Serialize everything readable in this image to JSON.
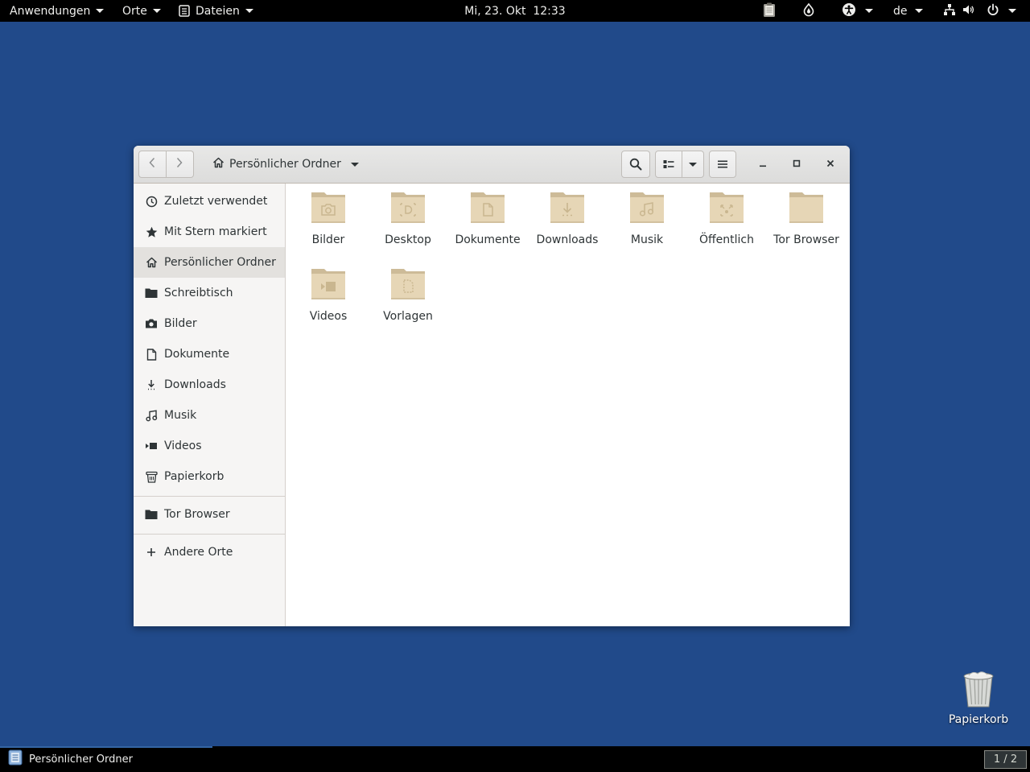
{
  "topbar": {
    "applications": "Anwendungen",
    "places": "Orte",
    "files_menu": "Dateien",
    "clock": "Mi, 23. Okt  12:33",
    "language": "de"
  },
  "window": {
    "location": "Persönlicher Ordner"
  },
  "sidebar": {
    "items": [
      {
        "label": "Zuletzt verwendet",
        "icon": "clock-icon"
      },
      {
        "label": "Mit Stern markiert",
        "icon": "star-icon"
      },
      {
        "label": "Persönlicher Ordner",
        "icon": "home-icon"
      },
      {
        "label": "Schreibtisch",
        "icon": "folder-icon"
      },
      {
        "label": "Bilder",
        "icon": "camera-icon"
      },
      {
        "label": "Dokumente",
        "icon": "document-icon"
      },
      {
        "label": "Downloads",
        "icon": "download-icon"
      },
      {
        "label": "Musik",
        "icon": "music-icon"
      },
      {
        "label": "Videos",
        "icon": "video-icon"
      },
      {
        "label": "Papierkorb",
        "icon": "trash-icon"
      }
    ],
    "bookmarks": [
      {
        "label": "Tor Browser",
        "icon": "folder-icon"
      }
    ],
    "other": {
      "label": "Andere Orte",
      "icon": "plus-icon"
    }
  },
  "files": [
    {
      "name": "Bilder",
      "emblem": "camera"
    },
    {
      "name": "Desktop",
      "emblem": "desktop"
    },
    {
      "name": "Dokumente",
      "emblem": "document"
    },
    {
      "name": "Downloads",
      "emblem": "download"
    },
    {
      "name": "Musik",
      "emblem": "music"
    },
    {
      "name": "Öffentlich",
      "emblem": "share"
    },
    {
      "name": "Tor Browser",
      "emblem": "none"
    },
    {
      "name": "Videos",
      "emblem": "video"
    },
    {
      "name": "Vorlagen",
      "emblem": "template"
    }
  ],
  "desktop": {
    "trash_label": "Papierkorb"
  },
  "bottombar": {
    "task_label": "Persönlicher Ordner",
    "workspace": "1 / 2"
  },
  "colors": {
    "desktop_bg": "#214a8a",
    "folder": "#e6d6b6",
    "active_sidebar": "#e3e1de"
  }
}
